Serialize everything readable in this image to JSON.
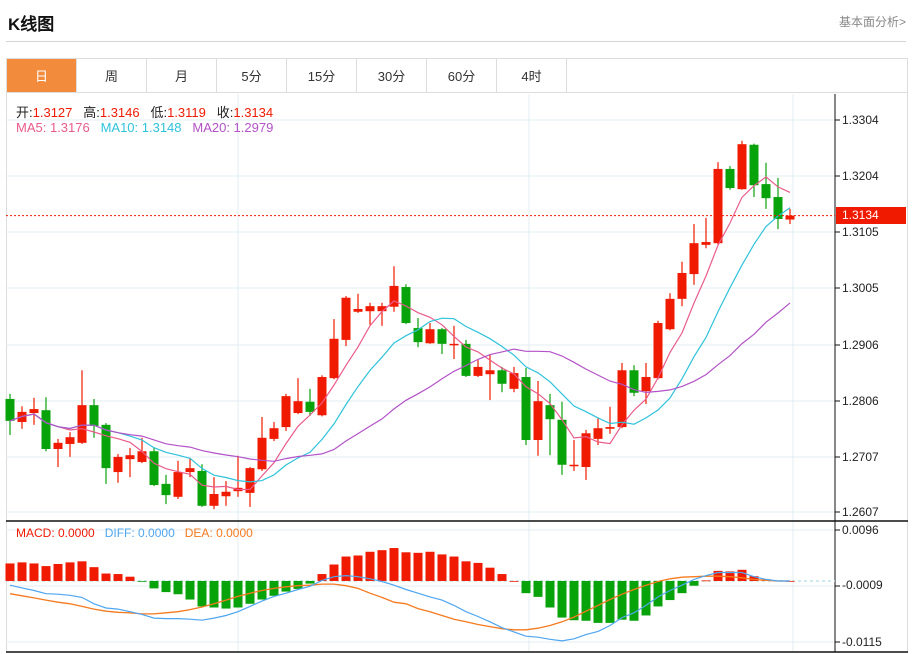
{
  "header": {
    "title": "K线图",
    "fundamental_link": "基本面分析>"
  },
  "tabs": [
    {
      "label": "日",
      "active": true
    },
    {
      "label": "周"
    },
    {
      "label": "月"
    },
    {
      "label": "5分"
    },
    {
      "label": "15分"
    },
    {
      "label": "30分"
    },
    {
      "label": "60分"
    },
    {
      "label": "4时"
    }
  ],
  "ohlc_legend": {
    "open_label": "开:",
    "open": "1.3127",
    "high_label": "高:",
    "high": "1.3146",
    "low_label": "低:",
    "low": "1.3119",
    "close_label": "收:",
    "close": "1.3134"
  },
  "ma_legend": {
    "ma5": "MA5: 1.3176",
    "ma10": "MA10: 1.3148",
    "ma20": "MA20: 1.2979"
  },
  "macd_legend": {
    "macd": "MACD: 0.0000",
    "diff": "DIFF: 0.0000",
    "dea": "DEA: 0.0000"
  },
  "current_price": "1.3134",
  "price_axis": {
    "labels": [
      "1.3304",
      "1.3204",
      "1.3105",
      "1.3005",
      "1.2906",
      "1.2806",
      "1.2707",
      "1.2607"
    ],
    "range": [
      1.2607,
      1.3304
    ]
  },
  "macd_axis": {
    "labels": [
      "0.0096",
      "-0.0009",
      "-0.0115"
    ],
    "range": [
      -0.0115,
      0.0096
    ]
  },
  "colors": {
    "up": "#f01a00",
    "down": "#08a20a",
    "ma5": "#ea5b8c",
    "ma10": "#2fc2dc",
    "ma20": "#b452c8",
    "diff": "#4ea6f0",
    "dea": "#f57a1e",
    "accent": "#f28c3c"
  },
  "chart_data": {
    "type": "candlestick",
    "candles": [
      [
        1.2808,
        1.2817,
        1.2744,
        1.2769
      ],
      [
        1.2767,
        1.2795,
        1.2755,
        1.2785
      ],
      [
        1.2783,
        1.281,
        1.2762,
        1.279
      ],
      [
        1.2788,
        1.2811,
        1.2715,
        1.2719
      ],
      [
        1.2719,
        1.2737,
        1.2687,
        1.273
      ],
      [
        1.2728,
        1.2749,
        1.2705,
        1.274
      ],
      [
        1.273,
        1.2859,
        1.2728,
        1.2797
      ],
      [
        1.2797,
        1.2808,
        1.2739,
        1.276
      ],
      [
        1.2762,
        1.2765,
        1.2657,
        1.2685
      ],
      [
        1.2678,
        1.271,
        1.2659,
        1.2705
      ],
      [
        1.2701,
        1.2721,
        1.2669,
        1.2708
      ],
      [
        1.2696,
        1.2739,
        1.2694,
        1.2715
      ],
      [
        1.2715,
        1.2721,
        1.2653,
        1.2655
      ],
      [
        1.2657,
        1.2673,
        1.2621,
        1.2637
      ],
      [
        1.2634,
        1.2698,
        1.263,
        1.2678
      ],
      [
        1.2678,
        1.2703,
        1.2669,
        1.2685
      ],
      [
        1.268,
        1.2692,
        1.2616,
        1.2618
      ],
      [
        1.2618,
        1.2669,
        1.2612,
        1.2639
      ],
      [
        1.2635,
        1.2662,
        1.2618,
        1.2643
      ],
      [
        1.2644,
        1.2707,
        1.2634,
        1.265
      ],
      [
        1.2641,
        1.2687,
        1.2616,
        1.2685
      ],
      [
        1.2683,
        1.2776,
        1.268,
        1.2739
      ],
      [
        1.2737,
        1.2767,
        1.2733,
        1.2756
      ],
      [
        1.2758,
        1.2817,
        1.2751,
        1.2813
      ],
      [
        1.2783,
        1.2845,
        1.2781,
        1.2804
      ],
      [
        1.2803,
        1.2826,
        1.2778,
        1.2785
      ],
      [
        1.2779,
        1.285,
        1.2777,
        1.2847
      ],
      [
        1.2845,
        1.295,
        1.2843,
        1.2915
      ],
      [
        1.2913,
        1.2991,
        1.2902,
        1.2988
      ],
      [
        1.2963,
        1.2995,
        1.2961,
        1.2968
      ],
      [
        1.2964,
        1.2979,
        1.294,
        1.2973
      ],
      [
        1.2964,
        1.2979,
        1.2938,
        1.2973
      ],
      [
        1.2972,
        1.3044,
        1.2963,
        1.3009
      ],
      [
        1.3007,
        1.3012,
        1.2941,
        1.2943
      ],
      [
        1.2934,
        1.2952,
        1.29,
        1.2909
      ],
      [
        1.2907,
        1.2943,
        1.2906,
        1.2932
      ],
      [
        1.2932,
        1.2934,
        1.2888,
        1.2906
      ],
      [
        1.2904,
        1.2938,
        1.2879,
        1.2906
      ],
      [
        1.2906,
        1.2913,
        1.2847,
        1.2849
      ],
      [
        1.2849,
        1.2877,
        1.2847,
        1.2865
      ],
      [
        1.2852,
        1.2886,
        1.2806,
        1.2859
      ],
      [
        1.2859,
        1.2865,
        1.282,
        1.2835
      ],
      [
        1.2826,
        1.2865,
        1.282,
        1.2854
      ],
      [
        1.2847,
        1.2863,
        1.2726,
        1.2735
      ],
      [
        1.2735,
        1.284,
        1.2707,
        1.2804
      ],
      [
        1.2797,
        1.2817,
        1.2708,
        1.2772
      ],
      [
        1.2771,
        1.2803,
        1.2673,
        1.2691
      ],
      [
        1.2689,
        1.2735,
        1.268,
        1.2691
      ],
      [
        1.2687,
        1.2753,
        1.2664,
        1.2747
      ],
      [
        1.2737,
        1.2774,
        1.2726,
        1.2756
      ],
      [
        1.2755,
        1.2794,
        1.2746,
        1.2758
      ],
      [
        1.2758,
        1.2872,
        1.2756,
        1.2859
      ],
      [
        1.2859,
        1.2868,
        1.2813,
        1.2819
      ],
      [
        1.2822,
        1.2872,
        1.2799,
        1.2847
      ],
      [
        1.2845,
        1.2947,
        1.2843,
        1.2943
      ],
      [
        1.2932,
        1.2996,
        1.293,
        1.2986
      ],
      [
        1.2986,
        1.3052,
        1.2973,
        1.3032
      ],
      [
        1.303,
        1.3119,
        1.3011,
        1.3085
      ],
      [
        1.3082,
        1.313,
        1.3076,
        1.3087
      ],
      [
        1.3085,
        1.3229,
        1.3083,
        1.3217
      ],
      [
        1.3217,
        1.3222,
        1.318,
        1.3183
      ],
      [
        1.3181,
        1.3267,
        1.318,
        1.3261
      ],
      [
        1.326,
        1.3262,
        1.3167,
        1.3188
      ],
      [
        1.319,
        1.3228,
        1.3146,
        1.3165
      ],
      [
        1.3167,
        1.3201,
        1.311,
        1.3128
      ],
      [
        1.3127,
        1.3146,
        1.3119,
        1.3134
      ]
    ],
    "ma_periods": [
      5,
      10,
      20
    ],
    "macd_hist": [
      0.0033,
      0.0035,
      0.0033,
      0.0028,
      0.0032,
      0.0035,
      0.0037,
      0.0026,
      0.0014,
      0.0013,
      0.0008,
      -0.0001,
      -0.0014,
      -0.0021,
      -0.0025,
      -0.0035,
      -0.0048,
      -0.005,
      -0.0052,
      -0.005,
      -0.0043,
      -0.0035,
      -0.0028,
      -0.002,
      -0.0015,
      -0.0005,
      0.0013,
      0.0031,
      0.0046,
      0.0048,
      0.0055,
      0.0058,
      0.0062,
      0.0054,
      0.0053,
      0.0055,
      0.005,
      0.0046,
      0.0037,
      0.0034,
      0.0025,
      0.0013,
      0.0,
      -0.0023,
      -0.003,
      -0.005,
      -0.0069,
      -0.0074,
      -0.0075,
      -0.0079,
      -0.0079,
      -0.0073,
      -0.0075,
      -0.0065,
      -0.0048,
      -0.0036,
      -0.0023,
      -0.0009,
      0.0001,
      0.0019,
      0.0018,
      0.0021,
      0.0009,
      0.0003,
      0.0001,
      0.0
    ],
    "diff": [
      -0.0008,
      -0.0013,
      -0.0018,
      -0.0024,
      -0.0025,
      -0.0027,
      -0.0031,
      -0.0043,
      -0.0051,
      -0.0053,
      -0.0058,
      -0.0063,
      -0.007,
      -0.0071,
      -0.0071,
      -0.0072,
      -0.0074,
      -0.007,
      -0.0065,
      -0.0058,
      -0.0048,
      -0.0038,
      -0.0029,
      -0.0023,
      -0.0016,
      -0.001,
      0.0001,
      0.0008,
      0.001,
      0.0008,
      0.0004,
      -0.0001,
      -0.0008,
      -0.0016,
      -0.0023,
      -0.003,
      -0.0036,
      -0.0046,
      -0.0058,
      -0.0067,
      -0.0077,
      -0.0088,
      -0.0096,
      -0.0104,
      -0.0106,
      -0.011,
      -0.0113,
      -0.0109,
      -0.0101,
      -0.0095,
      -0.0084,
      -0.0069,
      -0.006,
      -0.0046,
      -0.003,
      -0.0018,
      -0.0008,
      0.0003,
      0.001,
      0.0016,
      0.0016,
      0.0016,
      0.0008,
      0.0003,
      0.0,
      0.0
    ],
    "dea": [
      -0.0024,
      -0.0028,
      -0.0032,
      -0.0036,
      -0.004,
      -0.0043,
      -0.0048,
      -0.0053,
      -0.0057,
      -0.0059,
      -0.006,
      -0.0062,
      -0.0062,
      -0.006,
      -0.0058,
      -0.0054,
      -0.0049,
      -0.0043,
      -0.0036,
      -0.0029,
      -0.0023,
      -0.0018,
      -0.0014,
      -0.0011,
      -0.0009,
      -0.0008,
      -0.0006,
      -0.0006,
      -0.0009,
      -0.0014,
      -0.0023,
      -0.0031,
      -0.004,
      -0.0043,
      -0.0052,
      -0.0058,
      -0.0065,
      -0.0072,
      -0.0077,
      -0.0082,
      -0.0086,
      -0.009,
      -0.0092,
      -0.0092,
      -0.0089,
      -0.0084,
      -0.0077,
      -0.0068,
      -0.0057,
      -0.0046,
      -0.0035,
      -0.0025,
      -0.0016,
      -0.0008,
      -0.0001,
      0.0004,
      0.0007,
      0.0008,
      0.0009,
      0.0009,
      0.0008,
      0.0006,
      0.0003,
      0.0001,
      0.0,
      0.0
    ]
  }
}
